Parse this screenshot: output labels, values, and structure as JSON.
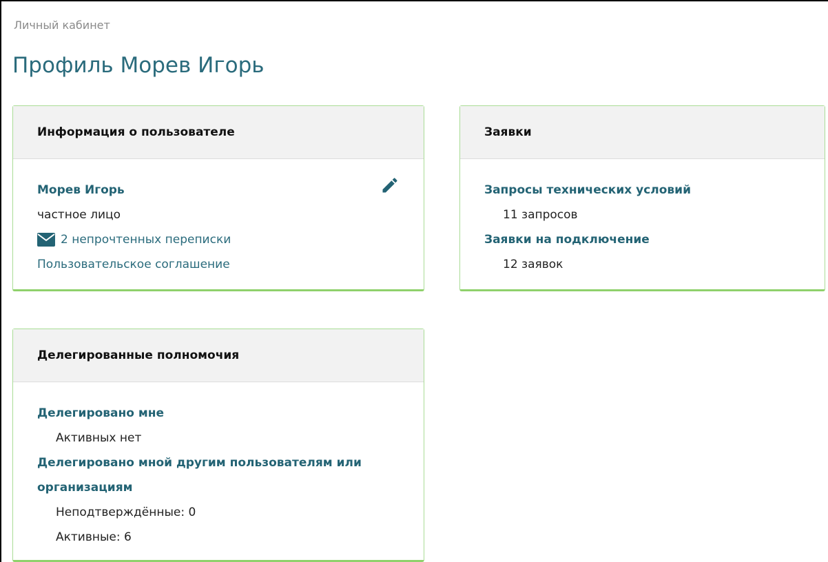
{
  "breadcrumb": "Личный кабинет",
  "page_title": "Профиль Морев Игорь",
  "user_card": {
    "title": "Информация о пользователе",
    "name": "Морев Игорь",
    "type": "частное лицо",
    "messages": "2 непрочтенных переписки",
    "agreement": "Пользовательское соглашение",
    "icons": {
      "edit": "pencil-icon",
      "mail": "envelope-icon"
    }
  },
  "requests_card": {
    "title": "Заявки",
    "tech_conditions_label": "Запросы технических условий",
    "tech_conditions_count": "11 запросов",
    "connection_label": "Заявки на подключение",
    "connection_count": "12 заявок"
  },
  "delegation_card": {
    "title": "Делегированные полномочия",
    "to_me_label": "Делегировано мне",
    "to_me_status": "Активных нет",
    "by_me_label": "Делегировано мной другим пользователям или организациям",
    "unconfirmed": "Неподтверждённые: 0",
    "active": "Активные: 6"
  },
  "colors": {
    "accent": "#2a6b7c",
    "card_border": "#a9dc95",
    "header_bg": "#f2f2f2"
  }
}
